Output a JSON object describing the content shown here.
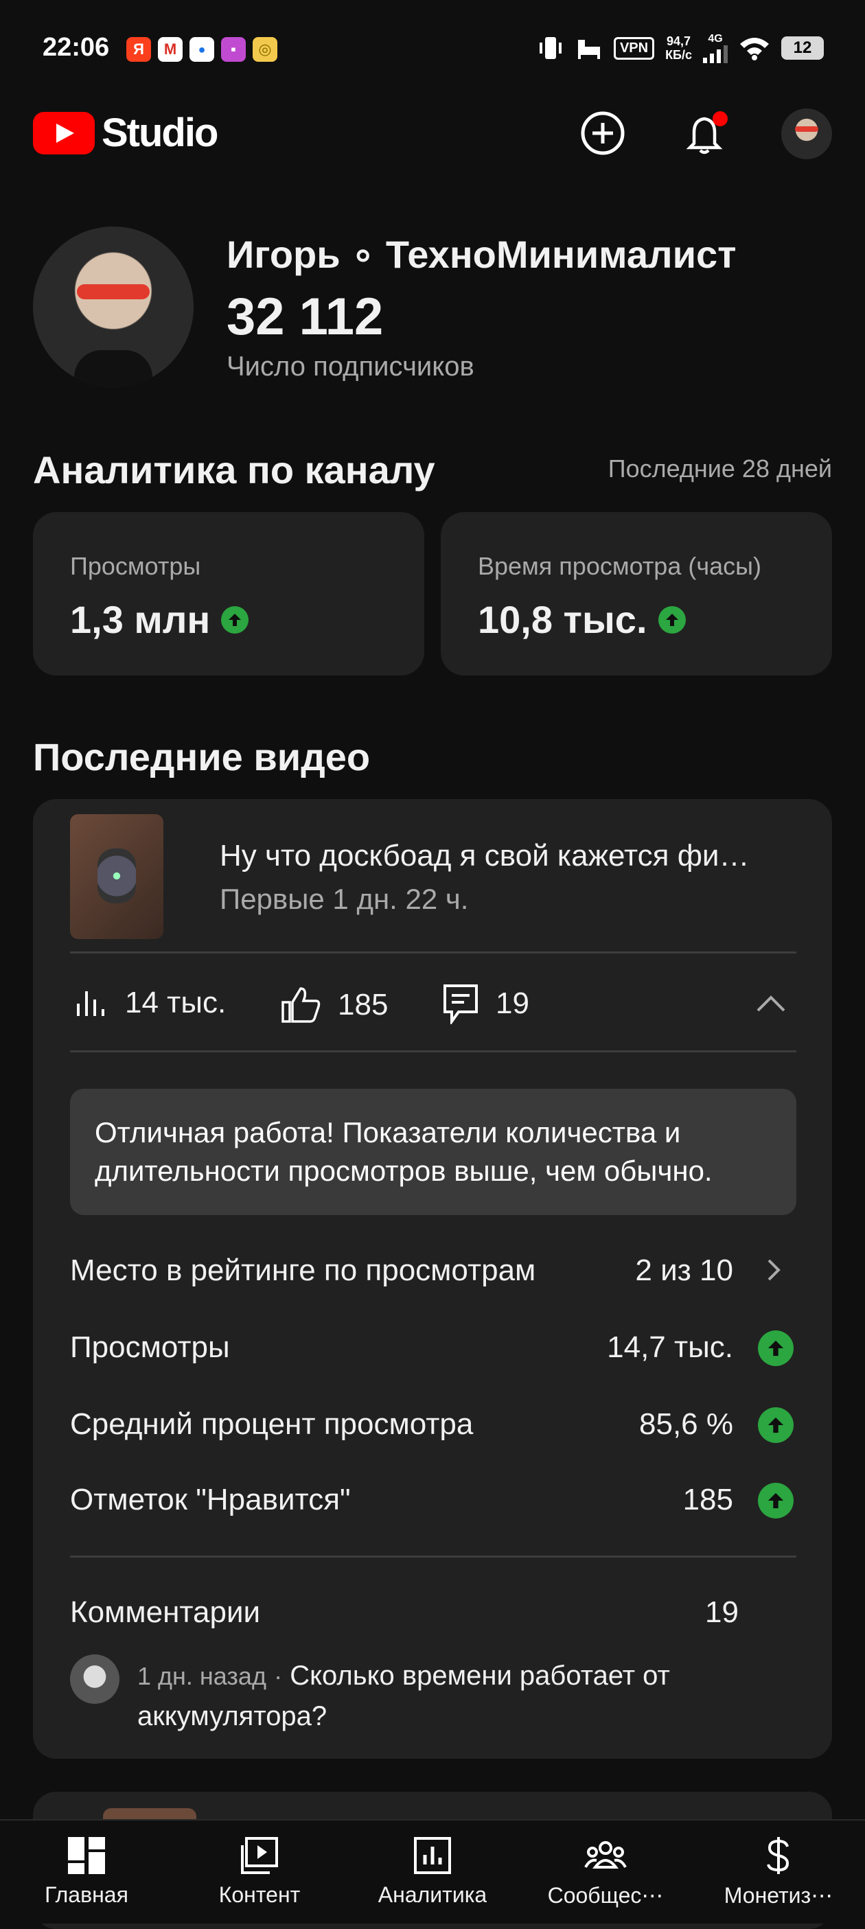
{
  "status_bar": {
    "time": "22:06",
    "app_icons": [
      {
        "name": "yandex-icon",
        "glyph": "Я",
        "color": "#fc3f1d"
      },
      {
        "name": "gmail-icon",
        "glyph": "M",
        "color": "#ffffff"
      },
      {
        "name": "app-dots-icon",
        "glyph": "●",
        "color": "#ffffff"
      },
      {
        "name": "calendar-icon",
        "glyph": "▪",
        "color": "#c04bd0"
      },
      {
        "name": "coin-icon",
        "glyph": "◎",
        "color": "#f2c94c"
      }
    ],
    "vpn": "VPN",
    "speed_value": "94,7",
    "speed_unit": "КБ/с",
    "network": "4G",
    "battery": "12"
  },
  "header": {
    "logo_text": "Studio"
  },
  "channel": {
    "name": "Игорь ∘ ТехноМинималист",
    "subscribers": "32 112",
    "subscribers_label": "Число подписчиков"
  },
  "analytics": {
    "title": "Аналитика по каналу",
    "period": "Последние 28 дней",
    "cards": [
      {
        "label": "Просмотры",
        "value": "1,3 млн"
      },
      {
        "label": "Время просмотра (часы)",
        "value": "10,8 тыс."
      }
    ]
  },
  "recent": {
    "title": "Последние видео",
    "video": {
      "title": "Ну что доскбоад я свой кажется фи…",
      "subtitle": "Первые 1 дн. 22 ч.",
      "views": "14 тыс.",
      "likes": "185",
      "comments": "19",
      "callout": "Отличная работа! Показатели количества и длительности просмотров выше, чем обычно.",
      "rows": [
        {
          "label": "Место в рейтинге по просмотрам",
          "value": "2 из 10"
        },
        {
          "label": "Просмотры",
          "value": "14,7 тыс."
        },
        {
          "label": "Средний процент просмотра",
          "value": "85,6 %"
        },
        {
          "label": "Отметок \"Нравится\"",
          "value": "185"
        }
      ],
      "comments_label": "Комментарии",
      "comments_count": "19",
      "comment": {
        "time": "1 дн. назад",
        "separator": "·",
        "text": "Сколько времени работает от аккумулятора?"
      }
    }
  },
  "nav": [
    {
      "label": "Главная"
    },
    {
      "label": "Контент"
    },
    {
      "label": "Аналитика"
    },
    {
      "label": "Сообщес⋯"
    },
    {
      "label": "Монетиз⋯"
    }
  ],
  "colors": {
    "background": "#0f0f0f",
    "card": "#212121",
    "accent_red": "#ff0000",
    "up_green": "#2ba640"
  }
}
